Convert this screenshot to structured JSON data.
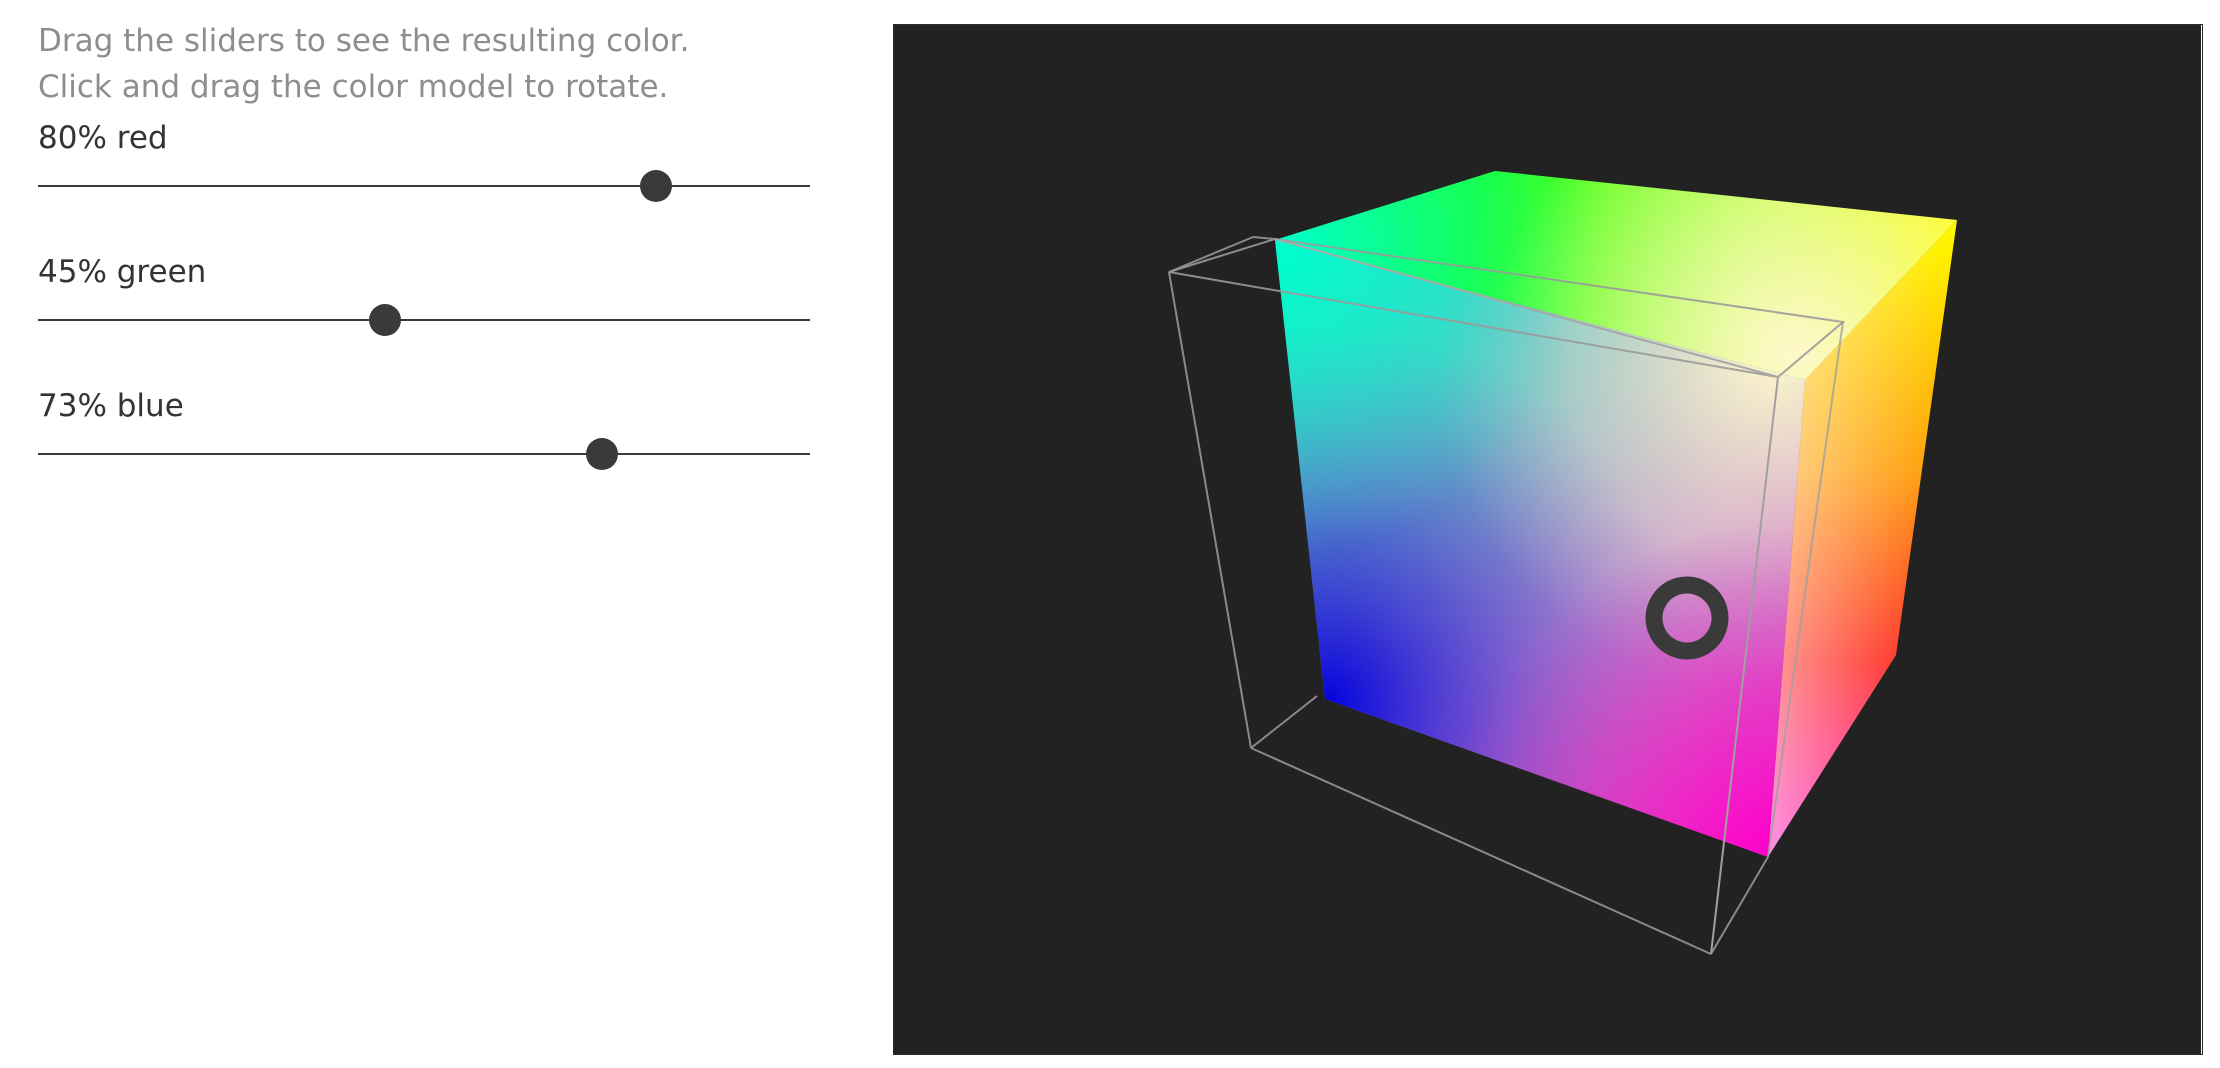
{
  "instructions": {
    "line1": "Drag the sliders to see the resulting color.",
    "line2": "Click and drag the color model to rotate."
  },
  "sliders": [
    {
      "label": "80% red",
      "channel": "red",
      "value": 0.8
    },
    {
      "label": "45% green",
      "channel": "green",
      "value": 0.45
    },
    {
      "label": "73% blue",
      "channel": "blue",
      "value": 0.73
    }
  ],
  "color_model": {
    "type": "RGB cube",
    "background": "#222222",
    "selected_color": {
      "r": 0.8,
      "g": 0.45,
      "b": 0.73
    },
    "corner_colors": {
      "top_left_front": "#00ffcc",
      "top_back": "#22ff00",
      "top_right": "#ffff00",
      "bottom_left_front": "#0000dd",
      "bottom_right_front": "#ff00cc",
      "right_bottom": "#ff0033"
    },
    "marker_color": "#333333",
    "wireframe_color": "#8a8a8a"
  }
}
